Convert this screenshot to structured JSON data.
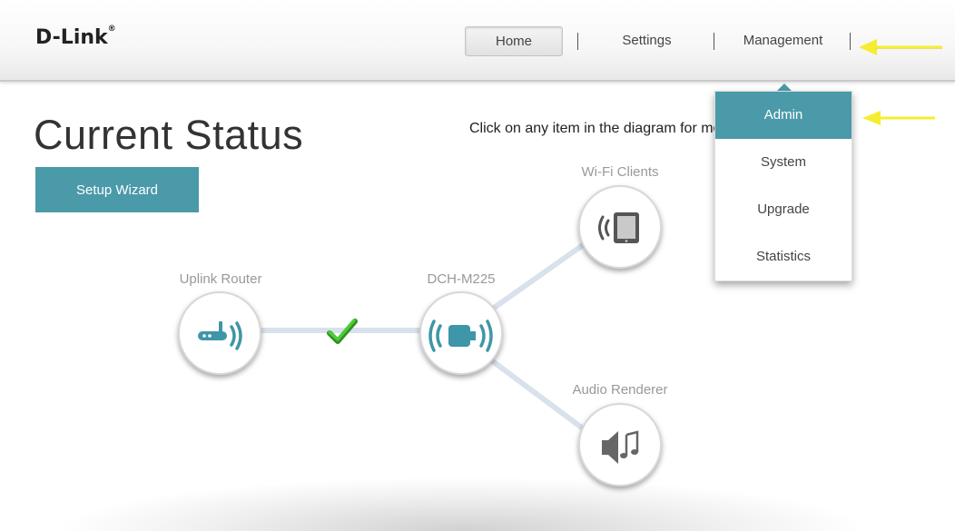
{
  "brand": {
    "logo_text": "D-Link",
    "registered_mark": "®"
  },
  "nav": {
    "home": "Home",
    "settings": "Settings",
    "management": "Management"
  },
  "page": {
    "title": "Current Status",
    "hint": "Click on any item in the diagram for more information."
  },
  "buttons": {
    "setup_wizard": "Setup Wizard"
  },
  "management_menu": {
    "items": [
      {
        "label": "Admin",
        "active": true
      },
      {
        "label": "System",
        "active": false
      },
      {
        "label": "Upgrade",
        "active": false
      },
      {
        "label": "Statistics",
        "active": false
      }
    ]
  },
  "diagram": {
    "uplink_router": {
      "label": "Uplink Router",
      "icon": "router-icon"
    },
    "device": {
      "label": "DCH-M225",
      "icon": "wifi-audio-extender-icon"
    },
    "wifi_clients": {
      "label": "Wi-Fi Clients",
      "icon": "tablet-wifi-icon"
    },
    "audio_renderer": {
      "label": "Audio Renderer",
      "icon": "speaker-music-icon"
    },
    "link_status_icon": "checkmark-icon"
  },
  "colors": {
    "accent": "#4a9aa9",
    "link_line": "#d9e1ec",
    "checkmark": "#3aaa2a",
    "annotation_arrow": "#f5ee30"
  }
}
